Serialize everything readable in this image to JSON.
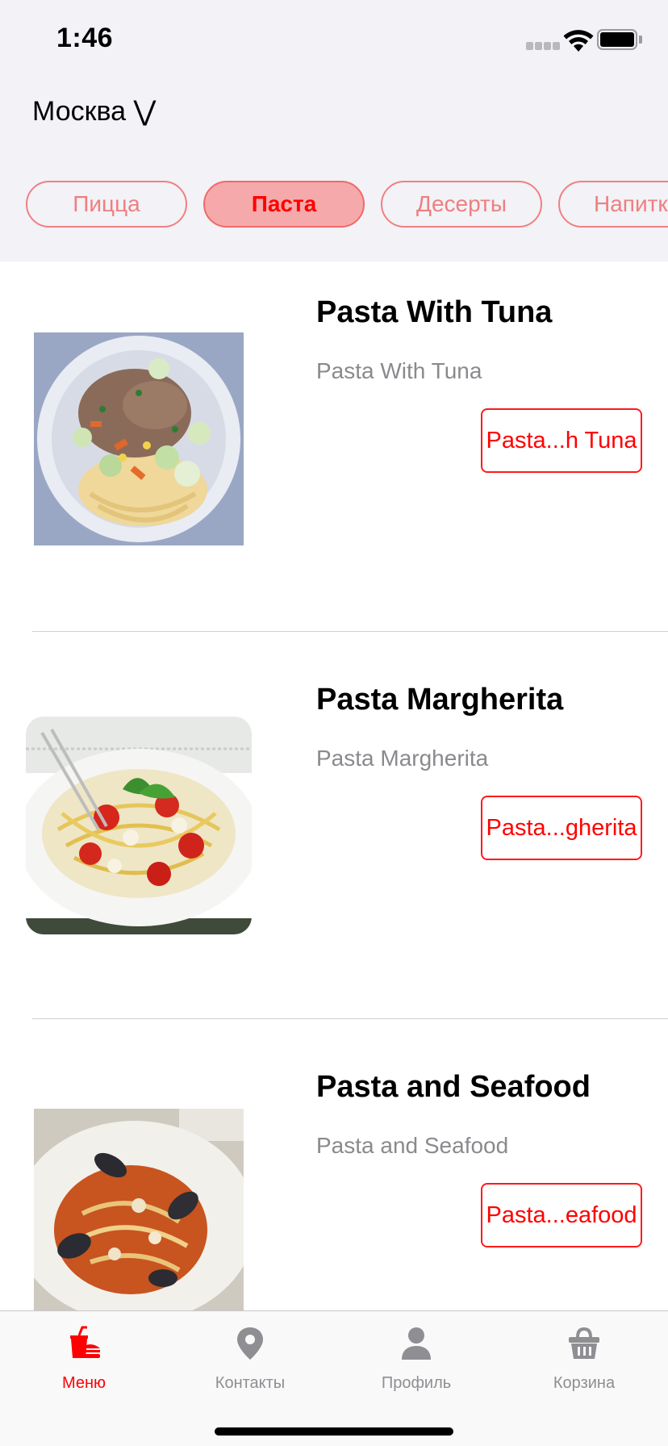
{
  "status_bar": {
    "time": "1:46"
  },
  "header": {
    "city": "Москва ⋁"
  },
  "categories": [
    {
      "label": "Пицца",
      "selected": false
    },
    {
      "label": "Паста",
      "selected": true
    },
    {
      "label": "Десерты",
      "selected": false
    },
    {
      "label": "Напитки",
      "selected": false
    }
  ],
  "menu_items": [
    {
      "title": "Pasta With Tuna",
      "subtitle": "Pasta With Tuna",
      "button_label": "Pasta...h Tuna",
      "image": "pasta-with-tuna-photo"
    },
    {
      "title": "Pasta Margherita",
      "subtitle": "Pasta Margherita",
      "button_label": "Pasta...gherita",
      "image": "pasta-margherita-photo"
    },
    {
      "title": "Pasta and Seafood",
      "subtitle": "Pasta and Seafood",
      "button_label": "Pasta...eafood",
      "image": "pasta-and-seafood-photo"
    }
  ],
  "tab_bar": {
    "tabs": [
      {
        "label": "Меню",
        "icon": "fastfood-icon",
        "active": true
      },
      {
        "label": "Контакты",
        "icon": "map-pin-icon",
        "active": false
      },
      {
        "label": "Профиль",
        "icon": "user-icon",
        "active": false
      },
      {
        "label": "Корзина",
        "icon": "basket-icon",
        "active": false
      }
    ]
  },
  "colors": {
    "accent": "#ff0000",
    "chip_border": "#f08080",
    "chip_active_bg": "#f6a9ab",
    "header_bg": "#f2f2f7",
    "inactive_tab": "#8e8e93"
  }
}
